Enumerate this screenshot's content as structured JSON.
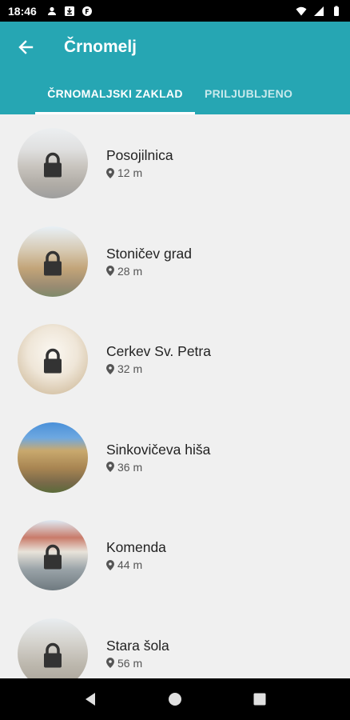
{
  "status": {
    "time": "18:46"
  },
  "appbar": {
    "title": "Črnomelj"
  },
  "tabs": [
    {
      "label": "ČRNOMALJSKI ZAKLAD"
    },
    {
      "label": "PRILJUBLJENO"
    }
  ],
  "items": [
    {
      "name": "Posojilnica",
      "distance": "12 m"
    },
    {
      "name": "Stoničev grad",
      "distance": "28 m"
    },
    {
      "name": "Cerkev Sv. Petra",
      "distance": "32 m"
    },
    {
      "name": "Sinkovičeva hiša",
      "distance": "36 m"
    },
    {
      "name": "Komenda",
      "distance": "44 m"
    },
    {
      "name": "Stara šola",
      "distance": "56 m"
    }
  ],
  "colors": {
    "appbar": "#26a6b3",
    "background": "#f0f0f0"
  }
}
